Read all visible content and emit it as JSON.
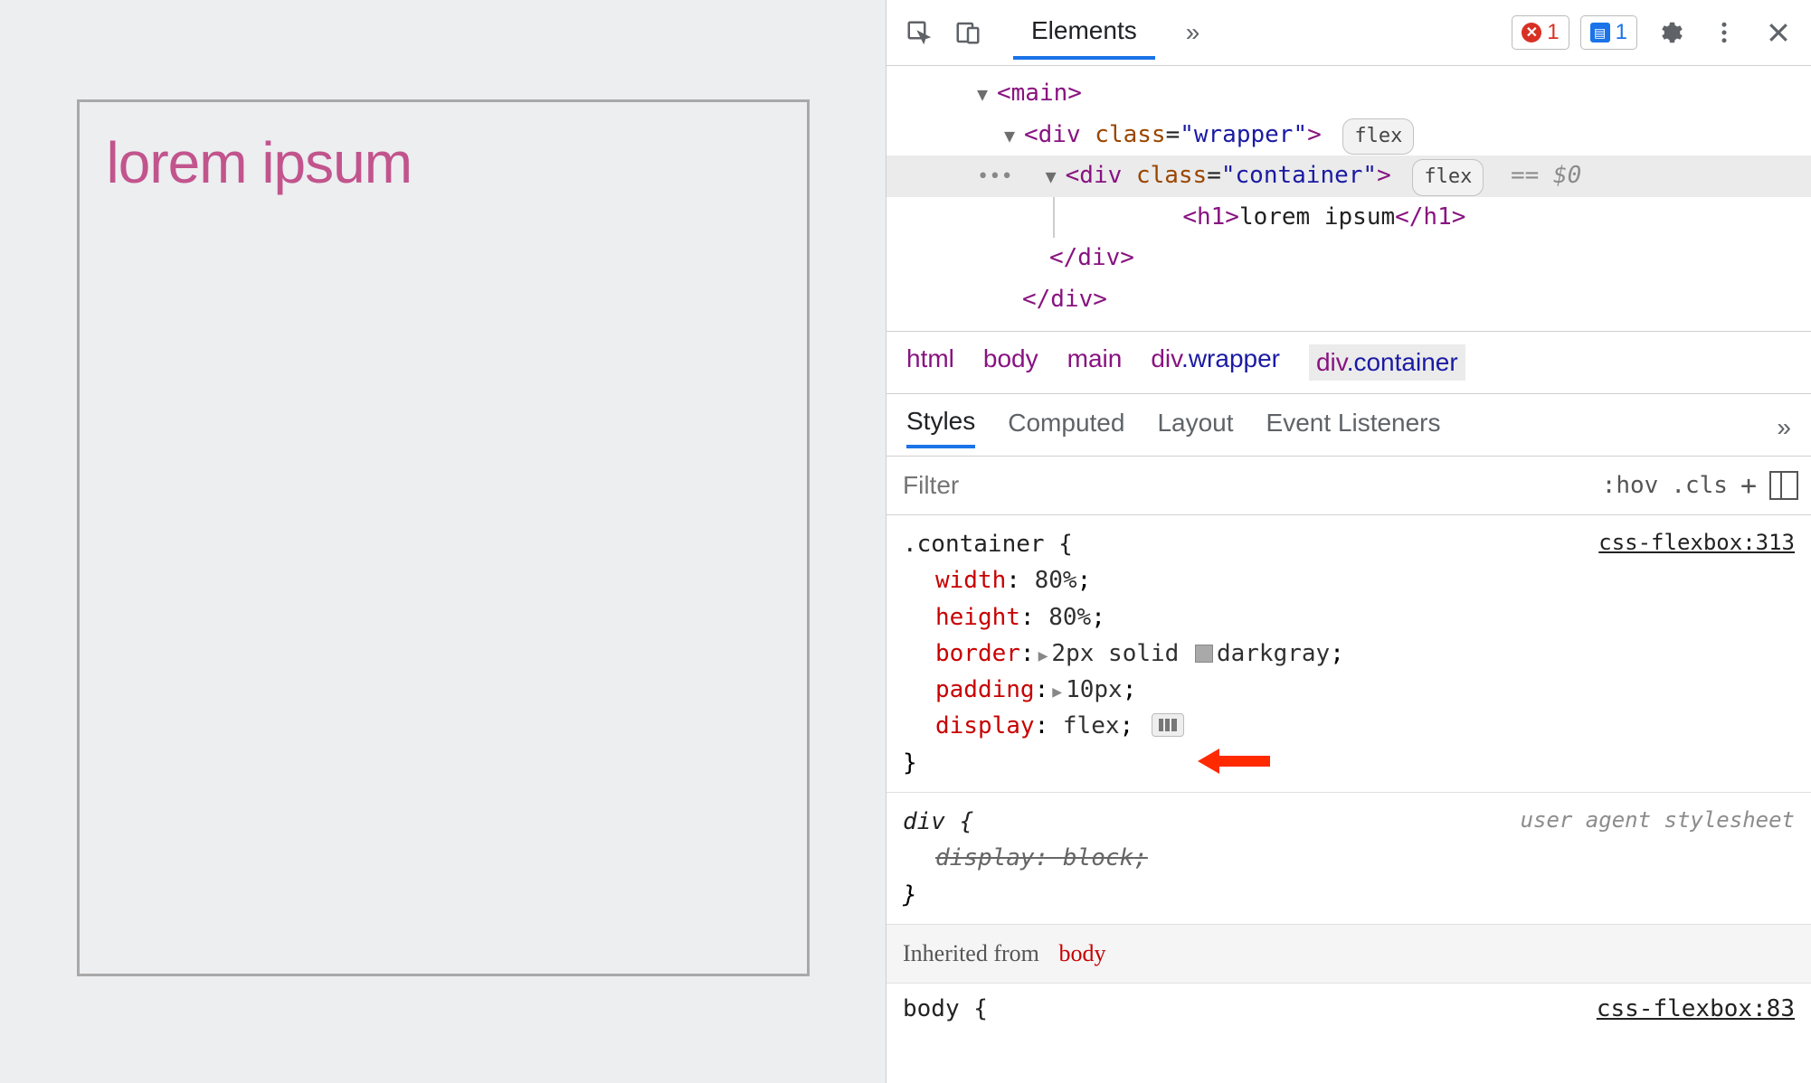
{
  "page": {
    "heading": "lorem ipsum"
  },
  "toolbar": {
    "tab_elements": "Elements",
    "error_count": "1",
    "msg_count": "1"
  },
  "dom": {
    "main_open": "<main>",
    "wrapper_open": "<div class=\"wrapper\">",
    "wrapper_pill": "flex",
    "container_open": "<div class=\"container\">",
    "container_pill": "flex",
    "eqdollar": "== $0",
    "h1_open": "<h1>",
    "h1_text": "lorem ipsum",
    "h1_close": "</h1>",
    "div_close1": "</div>",
    "div_close2": "</div>"
  },
  "breadcrumb": {
    "b0": "html",
    "b1": "body",
    "b2": "main",
    "b3_pre": "div",
    "b3_cls": ".wrapper",
    "b4_pre": "div",
    "b4_cls": ".container"
  },
  "subtabs": {
    "styles": "Styles",
    "computed": "Computed",
    "layout": "Layout",
    "event": "Event Listeners"
  },
  "filterbar": {
    "placeholder": "Filter",
    "hov": ":hov",
    "cls": ".cls"
  },
  "styles": {
    "container": {
      "selector": ".container {",
      "source": "css-flexbox:313",
      "p_width": "width",
      "v_width": "80%",
      "p_height": "height",
      "v_height": "80%",
      "p_border": "border",
      "v_border": "2px solid ",
      "v_border_color": "darkgray",
      "p_padding": "padding",
      "v_padding": "10px",
      "p_display": "display",
      "v_display": "flex",
      "close": "}"
    },
    "div": {
      "selector": "div {",
      "source": "user agent stylesheet",
      "p_display": "display",
      "v_display": "block",
      "close": "}"
    },
    "inherited_label": "Inherited from",
    "inherited_tag": "body",
    "body_selector": "body {",
    "body_source": "css-flexbox:83"
  }
}
